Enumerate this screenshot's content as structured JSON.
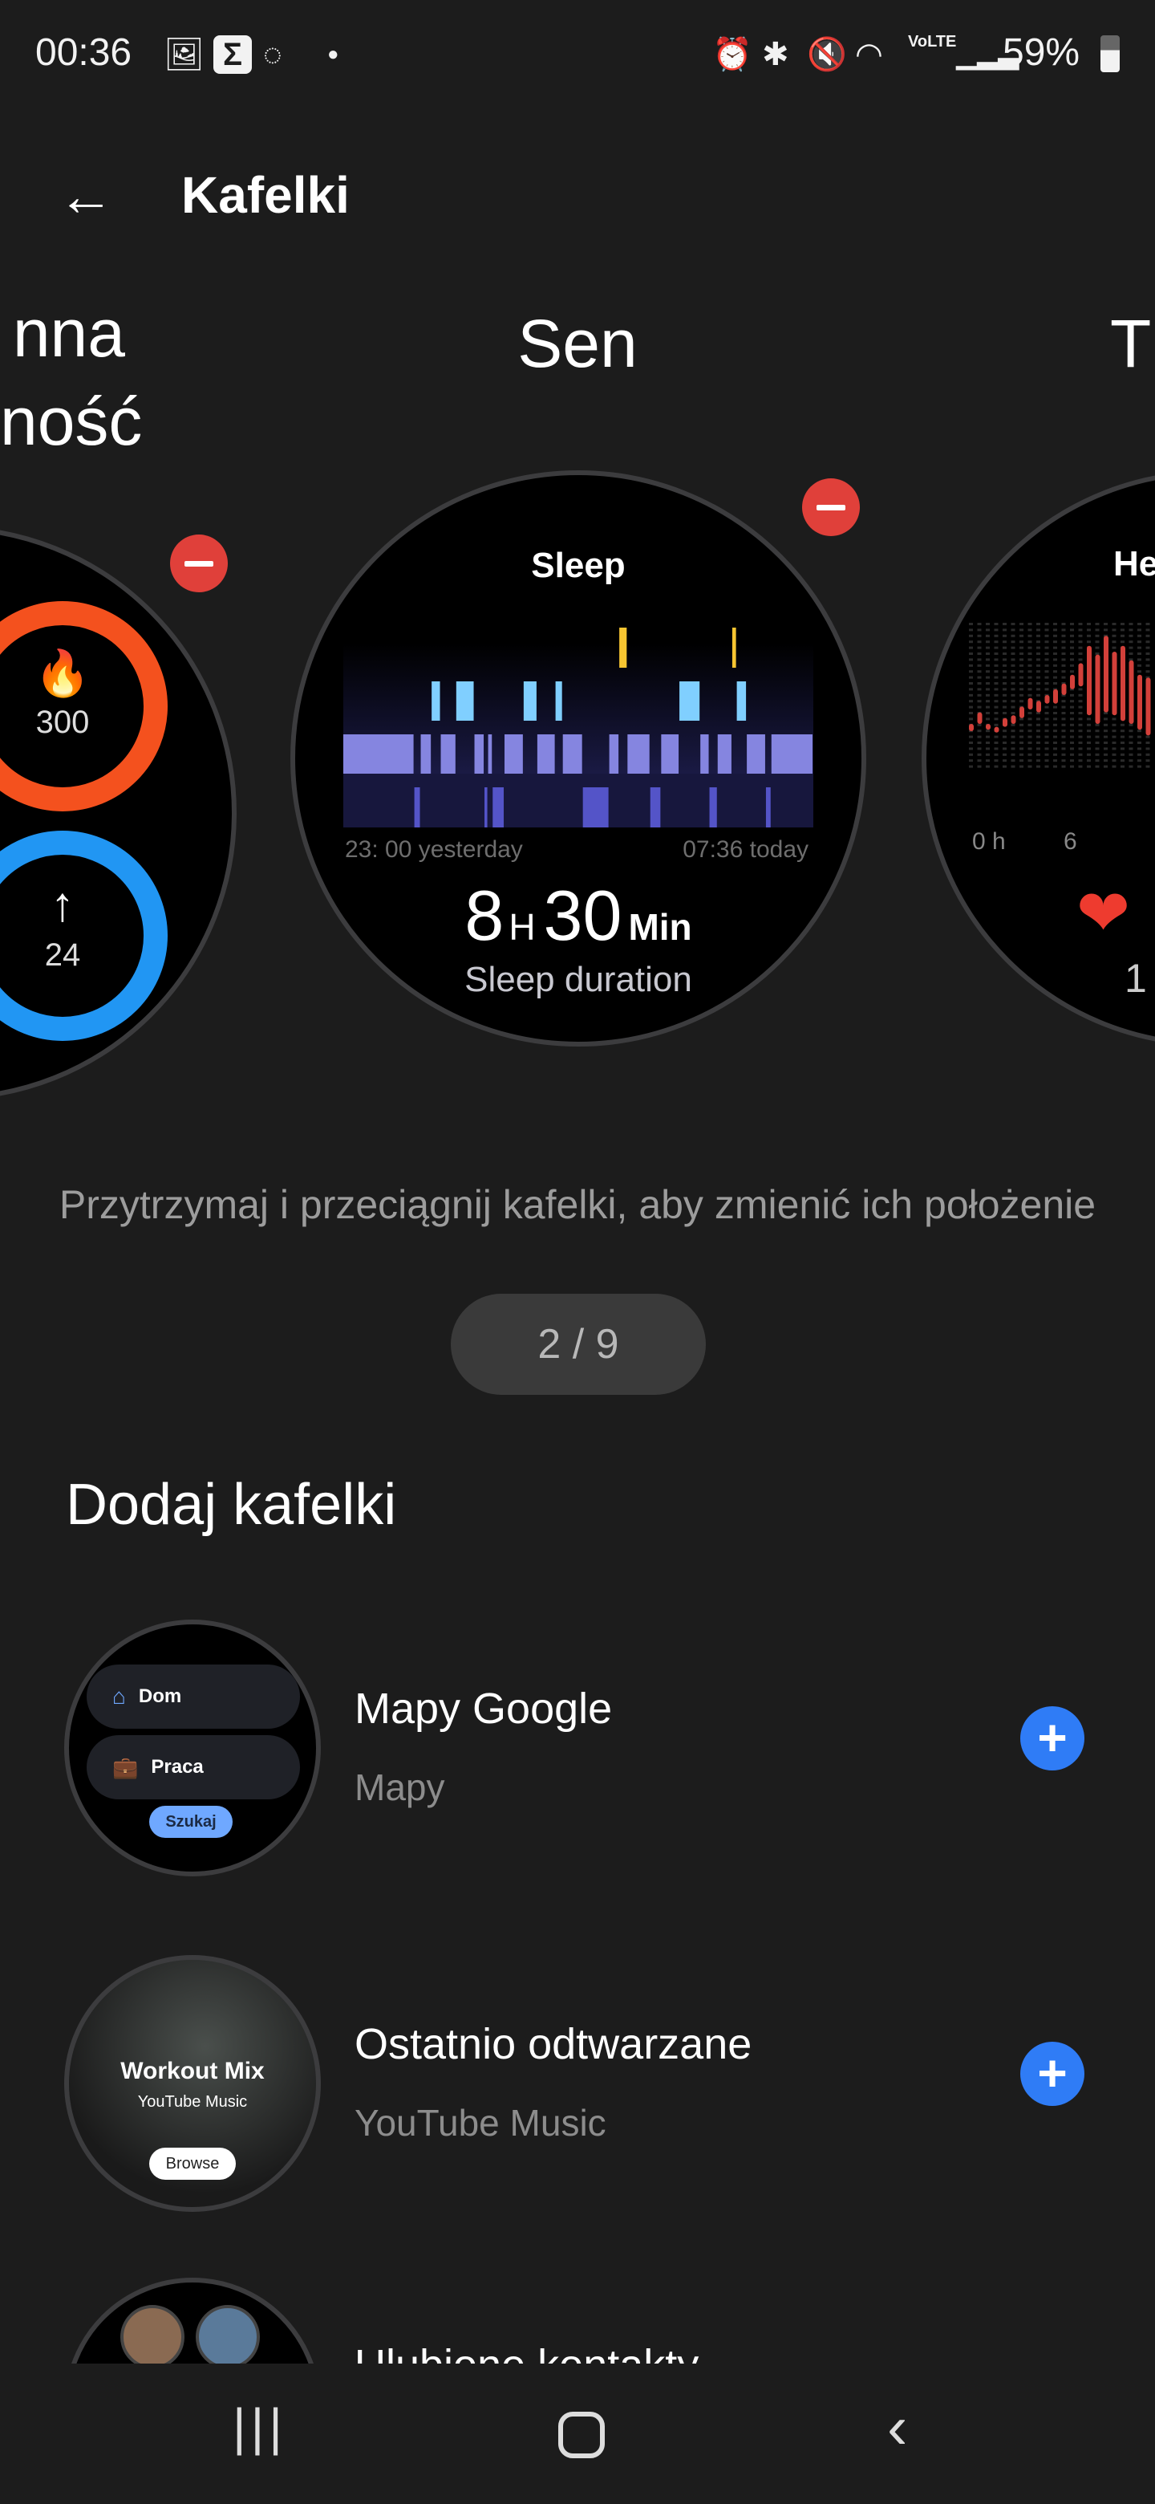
{
  "status_bar": {
    "time": "00:36",
    "battery": "59%",
    "network": "VoLTE",
    "icons_left": [
      "gallery-icon",
      "sigma-icon",
      "signal-messenger-icon",
      "dot-icon"
    ],
    "icons_right": [
      "alarm-icon",
      "bluetooth-icon",
      "mute-icon",
      "wifi-icon",
      "volte-icon",
      "cell-signal-icon",
      "battery-icon"
    ]
  },
  "header": {
    "title": "Kafelki",
    "back_icon": "arrow-left-icon"
  },
  "carousel": {
    "left": {
      "title_line1": "nna",
      "title_line2": "ność",
      "calories": "300",
      "steps": "24",
      "ring1_color": "#f4511e",
      "ring2_color": "#2196f3"
    },
    "center": {
      "title": "Sen",
      "tile_title": "Sleep",
      "start_label": "23: 00 yesterday",
      "end_label": "07:36 today",
      "hours": "8",
      "hours_unit": "H",
      "minutes": "30",
      "minutes_unit": "Min",
      "caption": "Sleep duration"
    },
    "right": {
      "title": "T",
      "tile_title": "He",
      "axis_start": "0 h",
      "axis_mid": "6",
      "value_partial": "1"
    }
  },
  "chart_data": {
    "type": "bar",
    "title": "Sleep",
    "x_start": "23: 00 yesterday",
    "x_end": "07:36 today",
    "stages": [
      "awake",
      "rem",
      "light",
      "deep"
    ],
    "stage_colors": {
      "awake": "#f7c531",
      "rem": "#80cfff",
      "light": "#8585e0",
      "deep": "#5454c8"
    },
    "segments_minutes": [
      [
        "light",
        78
      ],
      [
        "deep",
        7
      ],
      [
        "light",
        12
      ],
      [
        "rem",
        10
      ],
      [
        "light",
        17
      ],
      [
        "rem",
        20
      ],
      [
        "light",
        11
      ],
      [
        "deep",
        4
      ],
      [
        "light",
        5
      ],
      [
        "deep",
        13
      ],
      [
        "light",
        21
      ],
      [
        "rem",
        15
      ],
      [
        "light",
        20
      ],
      [
        "rem",
        8
      ],
      [
        "light",
        22
      ],
      [
        "deep",
        29
      ],
      [
        "light",
        11
      ],
      [
        "awake",
        9
      ],
      [
        "light",
        25
      ],
      [
        "deep",
        12
      ],
      [
        "light",
        20
      ],
      [
        "rem",
        23
      ],
      [
        "light",
        10
      ],
      [
        "deep",
        9
      ],
      [
        "light",
        16
      ],
      [
        "awake",
        5
      ],
      [
        "rem",
        11
      ],
      [
        "light",
        21
      ],
      [
        "deep",
        6
      ],
      [
        "light",
        46
      ]
    ],
    "heart_rate_bars": [
      [
        0.25,
        0.3
      ],
      [
        0.3,
        0.38
      ],
      [
        0.26,
        0.3
      ],
      [
        0.24,
        0.28
      ],
      [
        0.28,
        0.34
      ],
      [
        0.3,
        0.36
      ],
      [
        0.34,
        0.42
      ],
      [
        0.4,
        0.48
      ],
      [
        0.38,
        0.46
      ],
      [
        0.44,
        0.5
      ],
      [
        0.44,
        0.54
      ],
      [
        0.5,
        0.58
      ],
      [
        0.54,
        0.64
      ],
      [
        0.56,
        0.72
      ],
      [
        0.36,
        0.84
      ],
      [
        0.3,
        0.78
      ],
      [
        0.38,
        0.91
      ],
      [
        0.36,
        0.8
      ],
      [
        0.32,
        0.84
      ],
      [
        0.3,
        0.74
      ],
      [
        0.26,
        0.64
      ],
      [
        0.22,
        0.62
      ]
    ]
  },
  "hint": "Przytrzymaj i przeciągnij kafelki, aby zmienić ich położenie",
  "pager": "2 / 9",
  "add_section": {
    "title": "Dodaj kafelki",
    "items": [
      {
        "title": "Mapy Google",
        "subtitle": "Mapy",
        "preview": {
          "home": "Dom",
          "work": "Praca",
          "search": "Szukaj"
        }
      },
      {
        "title": "Ostatnio odtwarzane",
        "subtitle": "YouTube Music",
        "preview": {
          "playlist": "Workout Mix",
          "app": "YouTube Music",
          "button": "Browse"
        }
      },
      {
        "title": "Ulubione kontakty"
      }
    ]
  },
  "navbar": {
    "recents_icon": "recents-icon",
    "home_icon": "home-icon",
    "back_icon": "back-chevron-icon"
  },
  "colors": {
    "background": "#1c1c1c",
    "remove": "#e0403a",
    "add": "#2f7cf6",
    "accent_maps": "#6fa8ff"
  }
}
